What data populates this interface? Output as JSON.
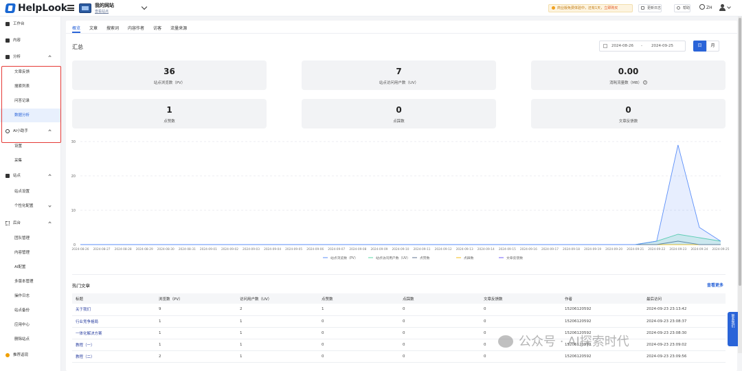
{
  "brand": {
    "name": "HelpLook"
  },
  "site": {
    "name": "我的网站",
    "view_link": "查看站点"
  },
  "topbar": {
    "notice": "商业版免费体验中，还有1天，",
    "notice_link": "立即购买",
    "changelog": "更新日志",
    "help": "帮助",
    "lang": "ZH"
  },
  "sidebar": {
    "items": [
      {
        "label": "工作台",
        "icon": "home-icon"
      },
      {
        "label": "内容",
        "icon": "document-icon"
      },
      {
        "label": "分析",
        "icon": "chart-icon"
      },
      {
        "label": "文章反馈"
      },
      {
        "label": "搜索列表"
      },
      {
        "label": "问答记录"
      },
      {
        "label": "数据分析"
      },
      {
        "label": "AI小助手",
        "icon": "ai-icon"
      },
      {
        "label": "设置"
      },
      {
        "label": "采集"
      },
      {
        "label": "站点",
        "icon": "monitor-icon"
      },
      {
        "label": "站点设置"
      },
      {
        "label": "个性化配置"
      },
      {
        "label": "后台",
        "icon": "grid-icon"
      },
      {
        "label": "团队管理"
      },
      {
        "label": "内容管理"
      },
      {
        "label": "AI配置"
      },
      {
        "label": "多版本管理"
      },
      {
        "label": "操作日志"
      },
      {
        "label": "站点备份"
      },
      {
        "label": "应用中心"
      },
      {
        "label": "删除站点"
      },
      {
        "label": "推荐返现",
        "icon": "bulb-icon"
      }
    ]
  },
  "tabs": [
    "概览",
    "文章",
    "搜索词",
    "内容作者",
    "访客",
    "流量来源"
  ],
  "summary": {
    "title": "汇总",
    "date_start": "2024-08-26",
    "date_sep": "-",
    "date_end": "2024-09-25",
    "btn_day": "日",
    "btn_month": "月",
    "cards": [
      {
        "value": "36",
        "label": "站点浏览数（PV）"
      },
      {
        "value": "7",
        "label": "站点访问用户数（UV）"
      },
      {
        "value": "0.00",
        "label": "消耗流量数（MB）"
      },
      {
        "value": "1",
        "label": "点赞数"
      },
      {
        "value": "0",
        "label": "点踩数"
      },
      {
        "value": "0",
        "label": "文章反馈数"
      }
    ]
  },
  "chart_data": {
    "type": "area",
    "x": [
      "2024-08-26",
      "2024-08-27",
      "2024-08-28",
      "2024-08-29",
      "2024-08-30",
      "2024-08-31",
      "2024-09-01",
      "2024-09-02",
      "2024-09-03",
      "2024-09-04",
      "2024-09-05",
      "2024-09-06",
      "2024-09-07",
      "2024-09-08",
      "2024-09-09",
      "2024-09-10",
      "2024-09-11",
      "2024-09-12",
      "2024-09-13",
      "2024-09-14",
      "2024-09-15",
      "2024-09-16",
      "2024-09-17",
      "2024-09-18",
      "2024-09-19",
      "2024-09-20",
      "2024-09-21",
      "2024-09-22",
      "2024-09-23",
      "2024-09-24",
      "2024-09-25"
    ],
    "ylim": [
      0,
      30
    ],
    "yticks": [
      0,
      10,
      20,
      30
    ],
    "series": [
      {
        "name": "站点浏览数（PV）",
        "color": "#5b8ff9",
        "values": [
          0,
          0,
          0,
          0,
          0,
          0,
          0,
          0,
          0,
          0,
          0,
          0,
          0,
          0,
          0,
          0,
          0,
          0,
          0,
          0,
          0,
          0,
          0,
          0,
          0,
          0,
          0,
          1,
          29,
          5,
          1
        ]
      },
      {
        "name": "站点访问用户数（UV）",
        "color": "#5ad8a6",
        "values": [
          0,
          0,
          0,
          0,
          0,
          0,
          0,
          0,
          0,
          0,
          0,
          0,
          0,
          0,
          0,
          0,
          0,
          0,
          0,
          0,
          0,
          0,
          0,
          0,
          0,
          0,
          0,
          1,
          3,
          2,
          1
        ]
      },
      {
        "name": "点赞数",
        "color": "#5d7092",
        "values": [
          0,
          0,
          0,
          0,
          0,
          0,
          0,
          0,
          0,
          0,
          0,
          0,
          0,
          0,
          0,
          0,
          0,
          0,
          0,
          0,
          0,
          0,
          0,
          0,
          0,
          0,
          0,
          0,
          1,
          0,
          0
        ]
      },
      {
        "name": "点踩数",
        "color": "#f6bd16",
        "values": [
          0,
          0,
          0,
          0,
          0,
          0,
          0,
          0,
          0,
          0,
          0,
          0,
          0,
          0,
          0,
          0,
          0,
          0,
          0,
          0,
          0,
          0,
          0,
          0,
          0,
          0,
          0,
          0,
          0,
          0,
          0
        ]
      },
      {
        "name": "文章反馈数",
        "color": "#6f5ef9",
        "values": [
          0,
          0,
          0,
          0,
          0,
          0,
          0,
          0,
          0,
          0,
          0,
          0,
          0,
          0,
          0,
          0,
          0,
          0,
          0,
          0,
          0,
          0,
          0,
          0,
          0,
          0,
          0,
          0,
          0,
          0,
          0
        ]
      }
    ]
  },
  "hot": {
    "title": "热门文章",
    "more": "查看更多",
    "columns": [
      "标题",
      "浏览数（PV）",
      "访问用户数（UV）",
      "点赞数",
      "点踩数",
      "文章反馈数",
      "作者",
      "最后访问"
    ],
    "rows": [
      [
        "关于我们",
        "9",
        "2",
        "1",
        "0",
        "0",
        "15206120592",
        "2024-09-23 23:13:42"
      ],
      [
        "行业竞争格局",
        "1",
        "1",
        "0",
        "0",
        "0",
        "15206120592",
        "2024-09-23 23:08:37"
      ],
      [
        "一体化解决方案",
        "1",
        "1",
        "0",
        "0",
        "0",
        "15206120592",
        "2024-09-23 23:08:30"
      ],
      [
        "教程（一）",
        "1",
        "1",
        "0",
        "0",
        "0",
        "15206120592",
        "2024-09-23 23:09:02"
      ],
      [
        "教程（二）",
        "2",
        "1",
        "0",
        "0",
        "0",
        "15206120592",
        "2024-09-23 23:09:56"
      ]
    ]
  },
  "feedback": "联系我们",
  "watermark": "公众号 · AI探索时代"
}
